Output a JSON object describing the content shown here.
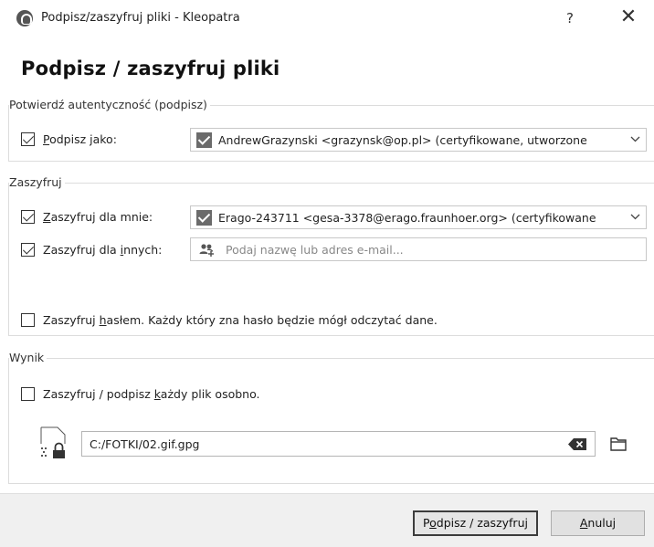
{
  "window": {
    "title": "Podpisz/zaszyfruj pliki - Kleopatra",
    "help_label": "?",
    "close_label": "✕"
  },
  "heading": "Podpisz / zaszyfruj pliki",
  "sign_group": {
    "legend": "Potwierdź autentyczność (podpisz)",
    "sign_as": {
      "checked": true,
      "label_prefix": "",
      "label_underline": "P",
      "label_rest": "odpisz jako:",
      "value": "AndrewGrazynski <grazynsk@op.pl> (certyfikowane,  utworzone"
    }
  },
  "encrypt_group": {
    "legend": "Zaszyfruj",
    "for_me": {
      "checked": true,
      "label_underline": "Z",
      "label_rest": "aszyfruj dla mnie:",
      "value": "Erago-243711 <gesa-3378@erago.fraunhoer.org> (certyfikowane"
    },
    "for_others": {
      "checked": true,
      "label_prefix": "Zaszyfruj dla ",
      "label_underline": "i",
      "label_rest": "nnych:",
      "placeholder": "Podaj nazwę lub adres e-mail..."
    },
    "password": {
      "checked": false,
      "label_prefix": "Zaszyfruj ",
      "label_underline": "h",
      "label_rest": "asłem. Każdy który zna hasło będzie mógł odczytać dane."
    }
  },
  "output_group": {
    "legend": "Wynik",
    "separately": {
      "checked": false,
      "label_prefix": "Zaszyfruj / podpisz ",
      "label_underline": "k",
      "label_rest": "ażdy plik osobno."
    },
    "output_path": "C:/FOTKI/02.gif.gpg"
  },
  "footer": {
    "primary_prefix": "P",
    "primary_underline": "o",
    "primary_rest": "dpisz / zaszyfruj",
    "cancel_underline": "A",
    "cancel_rest": "nuluj"
  }
}
